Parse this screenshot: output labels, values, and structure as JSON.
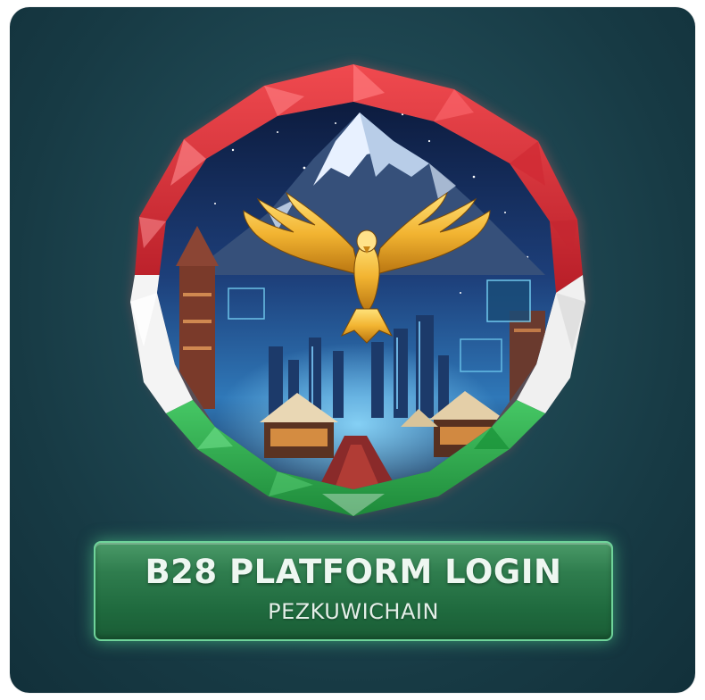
{
  "login_button": {
    "title": "B28 PLATFORM LOGIN",
    "subtitle": "PEZKUWICHAIN"
  },
  "colors": {
    "background": "#1f4853",
    "frame_red": "#e0343c",
    "frame_white": "#f4f4f4",
    "frame_green": "#2fb04f",
    "button_green": "#2f7d4e",
    "eagle_gold": "#f2b431"
  },
  "icons": {
    "emblem": "eagle-mountain-emblem-icon",
    "eagle": "golden-eagle-icon"
  }
}
